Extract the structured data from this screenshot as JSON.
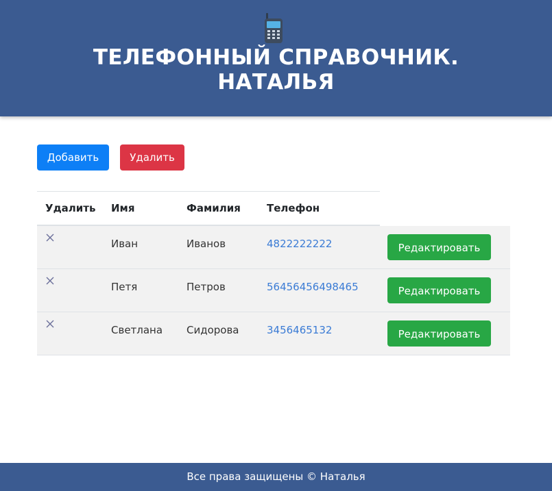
{
  "header": {
    "title_line1": "ТЕЛЕФОННЫЙ СПРАВОЧНИК.",
    "title_line2": "НАТАЛЬЯ",
    "icon": "mobile-phone-icon",
    "background_color": "#3b5b91"
  },
  "toolbar": {
    "add_label": "Добавить",
    "delete_label": "Удалить"
  },
  "table": {
    "columns": [
      "Удалить",
      "Имя",
      "Фамилия",
      "Телефон"
    ],
    "rows": [
      {
        "delete_icon": "close-icon",
        "first_name": "Иван",
        "last_name": "Иванов",
        "phone": "4822222222",
        "edit_label": "Редактировать"
      },
      {
        "delete_icon": "close-icon",
        "first_name": "Петя",
        "last_name": "Петров",
        "phone": "56456456498465",
        "edit_label": "Редактировать"
      },
      {
        "delete_icon": "close-icon",
        "first_name": "Светлана",
        "last_name": "Сидорова",
        "phone": "3456465132",
        "edit_label": "Редактировать"
      }
    ]
  },
  "footer": {
    "text": "Все права защищены © Наталья"
  },
  "colors": {
    "primary": "#0d7ff6",
    "danger": "#dc3545",
    "success": "#28a745",
    "link": "#3a7bd5"
  }
}
